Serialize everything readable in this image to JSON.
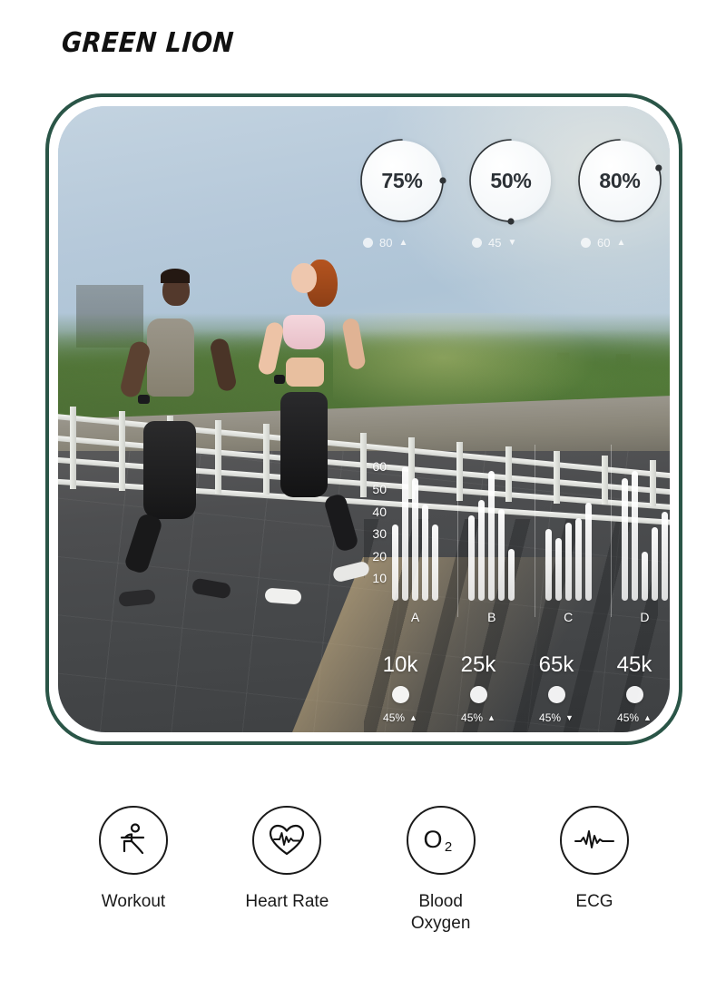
{
  "brand": {
    "name": "GREEN LION"
  },
  "device_panel": {
    "border_color": "#2a5547",
    "scene_description": "Two runners jogging on a bridge walkway at sunset"
  },
  "gauges": [
    {
      "name": "gauge-1",
      "value": "75%",
      "percent": 75,
      "sub_value": "80",
      "trend": "up",
      "trend_glyph": "▲"
    },
    {
      "name": "gauge-2",
      "value": "50%",
      "percent": 50,
      "sub_value": "45",
      "trend": "down",
      "trend_glyph": "▼"
    },
    {
      "name": "gauge-3",
      "value": "80%",
      "percent": 80,
      "sub_value": "60",
      "trend": "up",
      "trend_glyph": "▲"
    }
  ],
  "chart_data": {
    "type": "bar",
    "title": "",
    "xlabel": "",
    "ylabel": "",
    "ylim": [
      0,
      65
    ],
    "yticks": [
      10,
      20,
      30,
      40,
      50,
      60
    ],
    "grid": true,
    "legend": "none",
    "categories": [
      "A",
      "B",
      "C",
      "D"
    ],
    "groups": [
      {
        "label": "A",
        "values": [
          34,
          60,
          55,
          43,
          34
        ]
      },
      {
        "label": "B",
        "values": [
          38,
          45,
          58,
          41,
          23
        ]
      },
      {
        "label": "C",
        "values": [
          32,
          28,
          35,
          37,
          44
        ]
      },
      {
        "label": "D",
        "values": [
          55,
          58,
          22,
          33,
          40
        ]
      }
    ]
  },
  "stats": [
    {
      "name": "stat-1",
      "value": "10k",
      "delta": "45%",
      "trend": "up",
      "trend_glyph": "▲"
    },
    {
      "name": "stat-2",
      "value": "25k",
      "delta": "45%",
      "trend": "up",
      "trend_glyph": "▲"
    },
    {
      "name": "stat-3",
      "value": "65k",
      "delta": "45%",
      "trend": "down",
      "trend_glyph": "▼"
    },
    {
      "name": "stat-4",
      "value": "45k",
      "delta": "45%",
      "trend": "up",
      "trend_glyph": "▲"
    }
  ],
  "features": [
    {
      "name": "workout",
      "label": "Workout",
      "icon": "yoga-figure-icon"
    },
    {
      "name": "heart-rate",
      "label": "Heart Rate",
      "icon": "heart-pulse-icon"
    },
    {
      "name": "blood-oxygen",
      "label": "Blood\nOxygen",
      "icon": "o2-icon"
    },
    {
      "name": "ecg",
      "label": "ECG",
      "icon": "ecg-wave-icon"
    }
  ]
}
